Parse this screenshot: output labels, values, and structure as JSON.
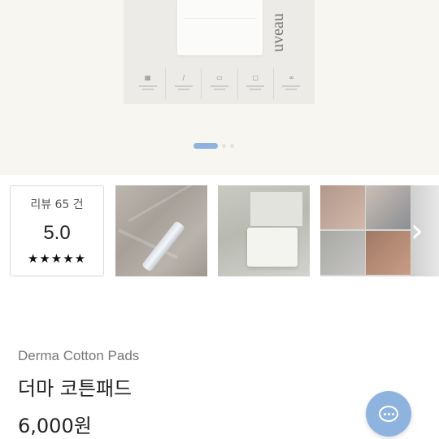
{
  "hero": {
    "brand_text": "uveau",
    "carousel_dots": [
      true,
      false,
      false
    ]
  },
  "review": {
    "label": "리뷰 65 건",
    "score": "5.0",
    "stars": "★★★★★"
  },
  "thumbnails": [
    "photo-1",
    "photo-2",
    "photo-3"
  ],
  "nav": {
    "next_arrow": "›"
  },
  "product": {
    "name_en": "Derma Cotton Pads",
    "name_ko": "더마 코튼패드",
    "price": "6,000원"
  },
  "colors": {
    "accent": "#8fb3df",
    "hero_bg": "#f8f6f1"
  },
  "icons": {
    "chat": "chat-bubble-icon",
    "next": "chevron-right-icon",
    "star": "star-icon"
  }
}
